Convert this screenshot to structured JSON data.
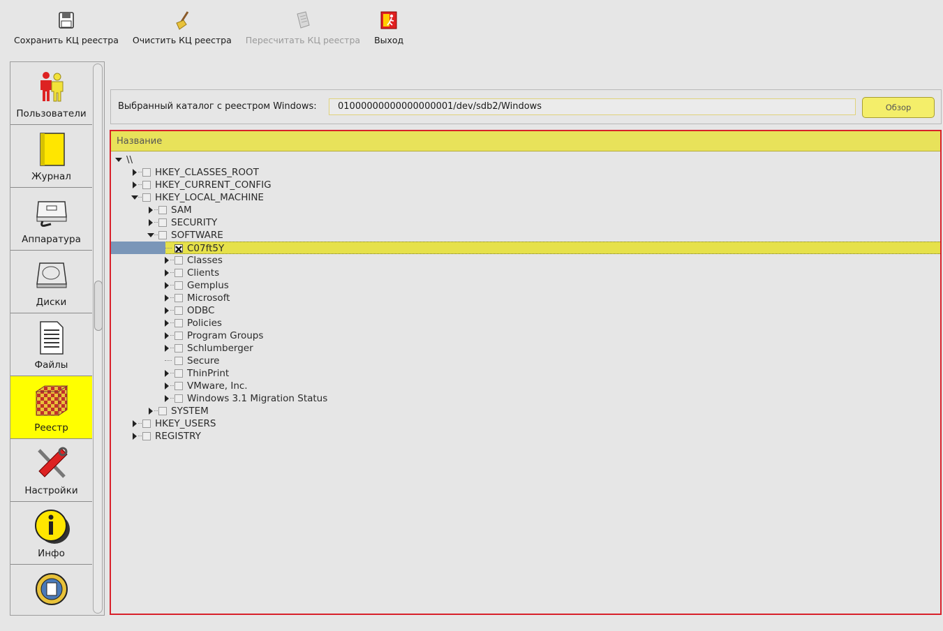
{
  "toolbar": {
    "buttons": [
      {
        "label": "Сохранить КЦ реестра",
        "icon": "save-icon",
        "enabled": true
      },
      {
        "label": "Очистить КЦ реестра",
        "icon": "broom-icon",
        "enabled": true
      },
      {
        "label": "Пересчитать КЦ реестра",
        "icon": "recalculate-icon",
        "enabled": false
      },
      {
        "label": "Выход",
        "icon": "exit-icon",
        "enabled": true
      }
    ]
  },
  "nav": {
    "items": [
      {
        "label": "Пользователи",
        "icon": "users-icon"
      },
      {
        "label": "Журнал",
        "icon": "journal-icon"
      },
      {
        "label": "Аппаратура",
        "icon": "hardware-icon"
      },
      {
        "label": "Диски",
        "icon": "disk-icon"
      },
      {
        "label": "Файлы",
        "icon": "file-icon"
      },
      {
        "label": "Реестр",
        "icon": "registry-cube-icon",
        "active": true
      },
      {
        "label": "Настройки",
        "icon": "tools-icon"
      },
      {
        "label": "Инфо",
        "icon": "info-icon"
      },
      {
        "label": "",
        "icon": "about-icon"
      }
    ]
  },
  "path": {
    "label": "Выбранный каталог с реестром Windows:",
    "value": "01000000000000000001/dev/sdb2/Windows",
    "browse_label": "Обзор"
  },
  "tree": {
    "column_header": "Название",
    "root_label": "\\\\",
    "nodes": [
      {
        "label": "HKEY_CLASSES_ROOT",
        "level": 1,
        "expander": "collapsed",
        "checked": false
      },
      {
        "label": "HKEY_CURRENT_CONFIG",
        "level": 1,
        "expander": "collapsed",
        "checked": false
      },
      {
        "label": "HKEY_LOCAL_MACHINE",
        "level": 1,
        "expander": "expanded",
        "checked": false
      },
      {
        "label": "SAM",
        "level": 2,
        "expander": "collapsed",
        "checked": false
      },
      {
        "label": "SECURITY",
        "level": 2,
        "expander": "collapsed",
        "checked": false
      },
      {
        "label": "SOFTWARE",
        "level": 2,
        "expander": "expanded",
        "checked": false
      },
      {
        "label": "C07ft5Y",
        "level": 3,
        "expander": "leaf",
        "checked": true,
        "selected": true
      },
      {
        "label": "Classes",
        "level": 3,
        "expander": "collapsed",
        "checked": false
      },
      {
        "label": "Clients",
        "level": 3,
        "expander": "collapsed",
        "checked": false
      },
      {
        "label": "Gemplus",
        "level": 3,
        "expander": "collapsed",
        "checked": false
      },
      {
        "label": "Microsoft",
        "level": 3,
        "expander": "collapsed",
        "checked": false
      },
      {
        "label": "ODBC",
        "level": 3,
        "expander": "collapsed",
        "checked": false
      },
      {
        "label": "Policies",
        "level": 3,
        "expander": "collapsed",
        "checked": false
      },
      {
        "label": "Program Groups",
        "level": 3,
        "expander": "collapsed",
        "checked": false
      },
      {
        "label": "Schlumberger",
        "level": 3,
        "expander": "collapsed",
        "checked": false
      },
      {
        "label": "Secure",
        "level": 3,
        "expander": "leaf",
        "checked": false
      },
      {
        "label": "ThinPrint",
        "level": 3,
        "expander": "collapsed",
        "checked": false
      },
      {
        "label": "VMware, Inc.",
        "level": 3,
        "expander": "collapsed",
        "checked": false
      },
      {
        "label": "Windows 3.1 Migration Status",
        "level": 3,
        "expander": "collapsed",
        "checked": false
      },
      {
        "label": "SYSTEM",
        "level": 2,
        "expander": "collapsed",
        "checked": false
      },
      {
        "label": "HKEY_USERS",
        "level": 1,
        "expander": "collapsed",
        "checked": false
      },
      {
        "label": "REGISTRY",
        "level": 1,
        "expander": "collapsed",
        "checked": false
      }
    ]
  },
  "colors": {
    "accent_yellow": "#ffff00",
    "header_yellow": "#e8e25a",
    "panel_border_red": "#d8202a",
    "selection_blue": "#7a96b8"
  }
}
